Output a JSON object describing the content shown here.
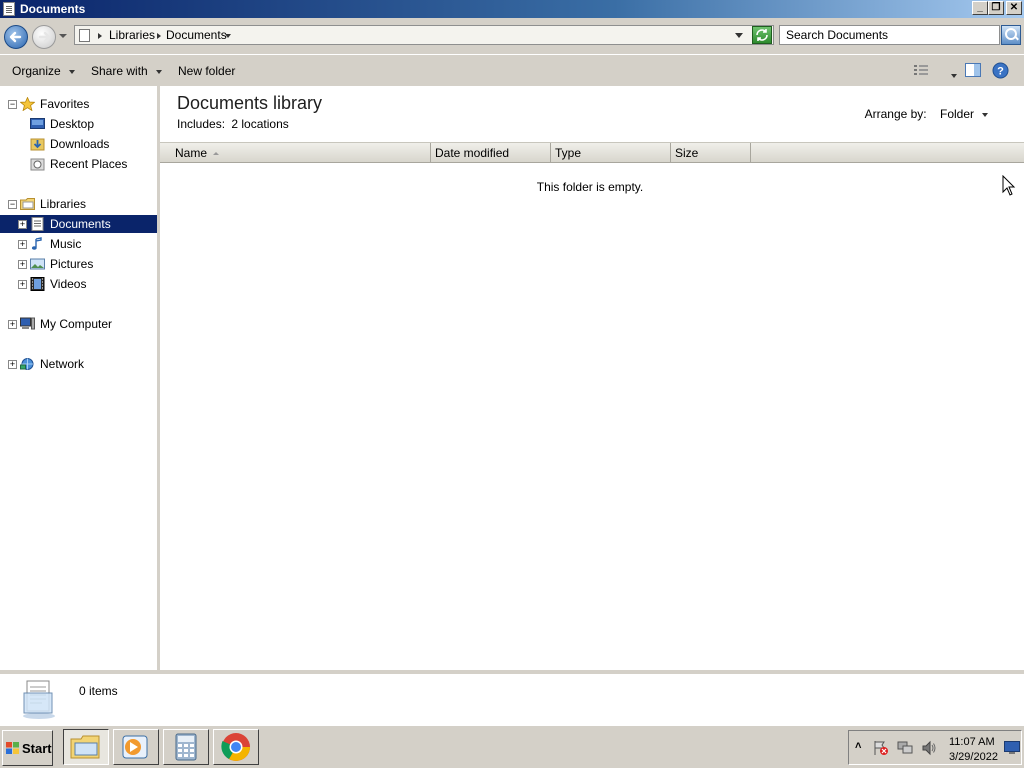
{
  "window": {
    "title": "Documents",
    "min_label": "_",
    "max_label": "❐",
    "close_label": "✕"
  },
  "address": {
    "crumbs": [
      "Libraries",
      "Documents"
    ],
    "search_placeholder": "Search Documents"
  },
  "toolbar": {
    "organize_label": "Organize",
    "share_label": "Share with",
    "new_folder_label": "New folder"
  },
  "sidebar": {
    "favorites_label": "Favorites",
    "favorites": [
      "Desktop",
      "Downloads",
      "Recent Places"
    ],
    "libraries_label": "Libraries",
    "libraries": [
      "Documents",
      "Music",
      "Pictures",
      "Videos"
    ],
    "computer_label": "My Computer",
    "network_label": "Network"
  },
  "main": {
    "title": "Documents library",
    "includes_label": "Includes:",
    "includes_value": "2 locations",
    "arrange_label": "Arrange by:",
    "arrange_value": "Folder",
    "columns": [
      "Name",
      "Date modified",
      "Type",
      "Size"
    ],
    "empty_message": "This folder is empty."
  },
  "details": {
    "item_count": "0 items"
  },
  "taskbar": {
    "start_label": "Start",
    "time": "11:07 AM",
    "date": "3/29/2022"
  },
  "colors": {
    "selection": "#0a246a",
    "chrome": "#d4d0c8"
  }
}
